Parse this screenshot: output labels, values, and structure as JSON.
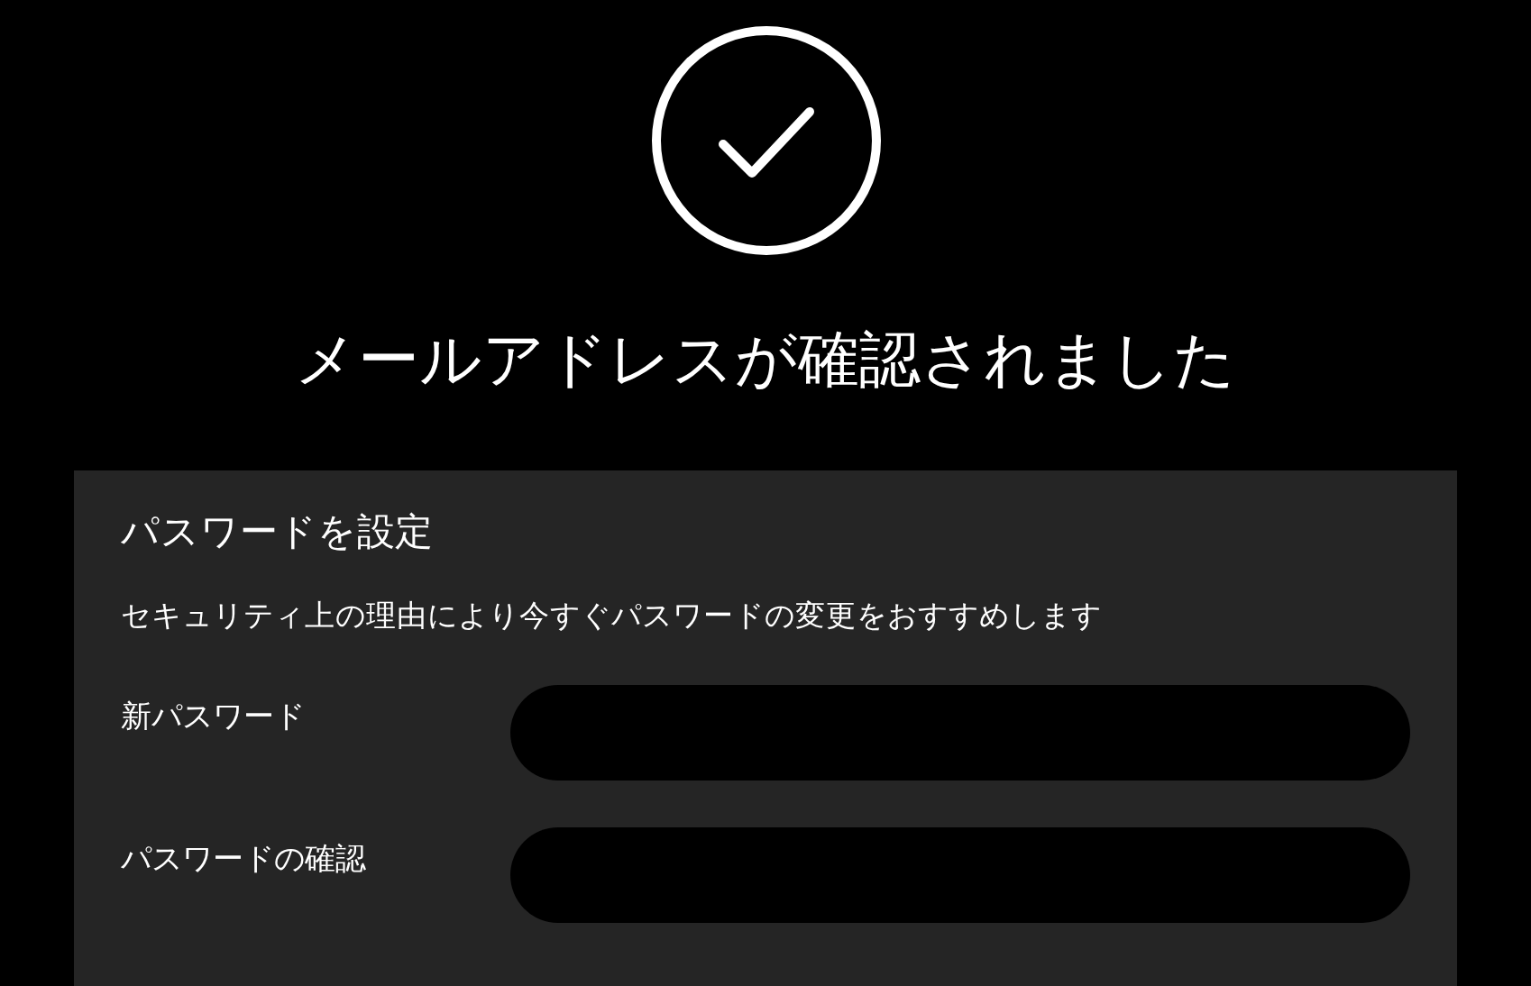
{
  "heading": "メールアドレスが確認されました",
  "panel": {
    "title": "パスワードを設定",
    "description": "セキュリティ上の理由により今すぐパスワードの変更をおすすめします",
    "fields": [
      {
        "label": "新パスワード"
      },
      {
        "label": "パスワードの確認"
      }
    ]
  }
}
